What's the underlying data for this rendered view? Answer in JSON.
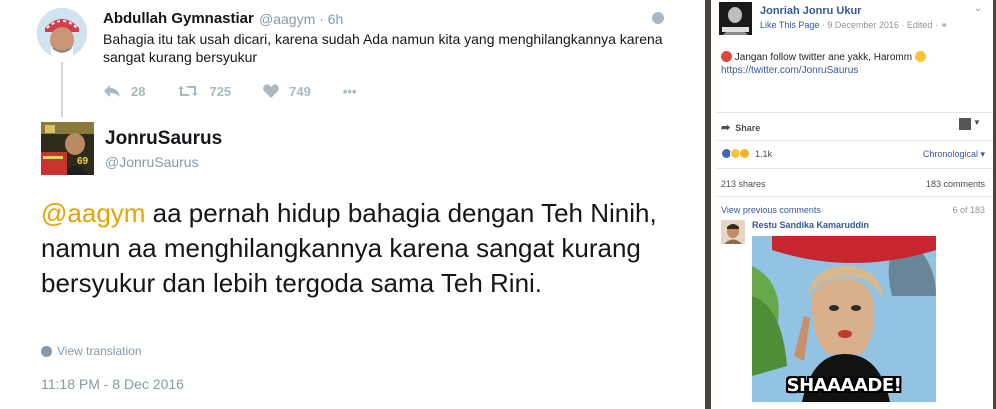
{
  "twitter": {
    "reply_tweet": {
      "author_name": "Abdullah Gymnastiar",
      "handle_time": "@aagym · 6h",
      "text": "Bahagia itu tak usah dicari, karena sudah Ada namun kita yang menghilangkannya karena sangat kurang bersyukur",
      "reply_count": "28",
      "retweet_count": "725",
      "like_count": "749",
      "more_label": "•••"
    },
    "main_tweet": {
      "author_name": "JonruSaurus",
      "handle": "@JonruSaurus",
      "mention": "@aagym",
      "text": " aa pernah hidup bahagia dengan Teh Ninih, namun aa menghilangkannya karena sangat kurang bersyukur dan lebih tergoda sama Teh Rini.",
      "view_translation": "View translation",
      "timestamp": "11:18 PM - 8 Dec 2016",
      "avatar_badge": "69"
    },
    "icons": [
      "reply-icon",
      "retweet-icon",
      "heart-icon",
      "more-icon",
      "globe-icon"
    ]
  },
  "facebook": {
    "page_name": "Jonriah Jonru Ukur",
    "meta_like": "Like This Page",
    "meta_rest": " · 9 December 2016 · Edited · ",
    "post_text": "Jangan follow twitter ane yakk, Haromm",
    "post_link": "https://twitter.com/JonruSaurus",
    "share_label": "Share",
    "reaction_count": "1.1k",
    "order_label": "Chronological",
    "shares": "213 shares",
    "comments": "183 comments",
    "view_previous": "View previous comments",
    "pagination": "6 of 183",
    "commenter": "Restu Sandika Kamaruddin",
    "gif_caption": "SHAAAADE!",
    "colors": {
      "link": "#365899",
      "like_blue": "#4267b2",
      "haha_yellow": "#f7c33c",
      "mention_yellow": "#e2a600"
    }
  }
}
